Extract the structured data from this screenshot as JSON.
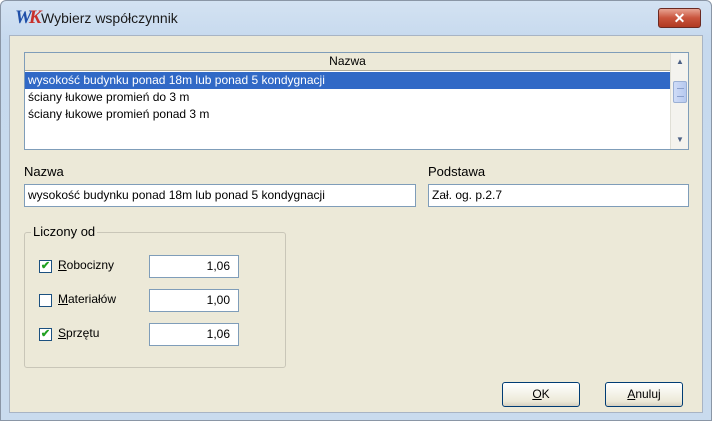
{
  "window": {
    "title": "Wybierz współczynnik",
    "close_symbol": "✕",
    "app_icon": "wk-app-icon",
    "close_button_color": "#c9543c"
  },
  "list": {
    "header": "Nazwa",
    "selection_color": "#3169c6",
    "rows": [
      "wysokość budynku ponad 18m lub ponad 5 kondygnacji",
      "ściany łukowe promień do 3 m",
      "ściany łukowe promień ponad 3 m"
    ]
  },
  "fields": {
    "nazwa_label": "Nazwa",
    "nazwa_value": "wysokość budynku ponad 18m lub ponad 5 kondygnacji",
    "podstawa_label": "Podstawa",
    "podstawa_value": "Zał. og. p.2.7"
  },
  "liczony_od": {
    "title": "Liczony od",
    "items": [
      {
        "access_key": "R",
        "label_rest": "obocizny",
        "checked": true,
        "value": "1,06"
      },
      {
        "access_key": "M",
        "label_rest": "ateriałów",
        "checked": false,
        "value": "1,00"
      },
      {
        "access_key": "S",
        "label_rest": "przętu",
        "checked": true,
        "value": "1,06"
      }
    ]
  },
  "buttons": {
    "ok_key": "O",
    "ok_rest": "K",
    "cancel_key": "A",
    "cancel_rest": "nuluj"
  },
  "icons": {
    "check_mark": "✔",
    "scroll_up": "▲",
    "scroll_down": "▼"
  }
}
